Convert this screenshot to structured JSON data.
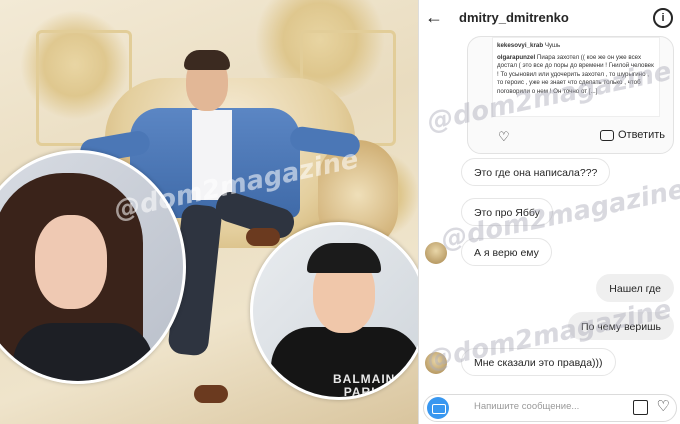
{
  "watermarks": {
    "left": "@dom2magazine",
    "right_top": "@dom2magazine",
    "right_mid": "@dom2magazine",
    "right_low": "@dom2magazine"
  },
  "guy_shirt_text": "BALMAIN\nPARIS",
  "header": {
    "back_icon": "arrow-left-icon",
    "username": "dmitry_dmitrenko",
    "info_icon": "i"
  },
  "shared_post": {
    "line1_user": "kekesovyi_krab",
    "line1_text": "Чушь",
    "line2_user": "olgarapunzel",
    "line2_text": "Пиара захотел (( кое же он уже всех достал ( это все до поры до времени ! Гнилой человек ! То усыновил или удочерить захотел , то шурыгино , то героиc , уже не знает что сделать только , чтоб поговорили о нем ! Он точно от [...]",
    "reply_label": "Ответить"
  },
  "messages": [
    {
      "text": "Это где она написала???",
      "from": "them"
    },
    {
      "text": "Это про Яббу",
      "from": "them"
    },
    {
      "text": "А я верю ему",
      "from": "them"
    },
    {
      "text": "Нашел где",
      "from": "me"
    },
    {
      "text": "По чему веришь",
      "from": "me"
    },
    {
      "text": "Мне сказали это правда)))",
      "from": "them"
    }
  ],
  "composer": {
    "placeholder": "Напишите сообщение..."
  }
}
